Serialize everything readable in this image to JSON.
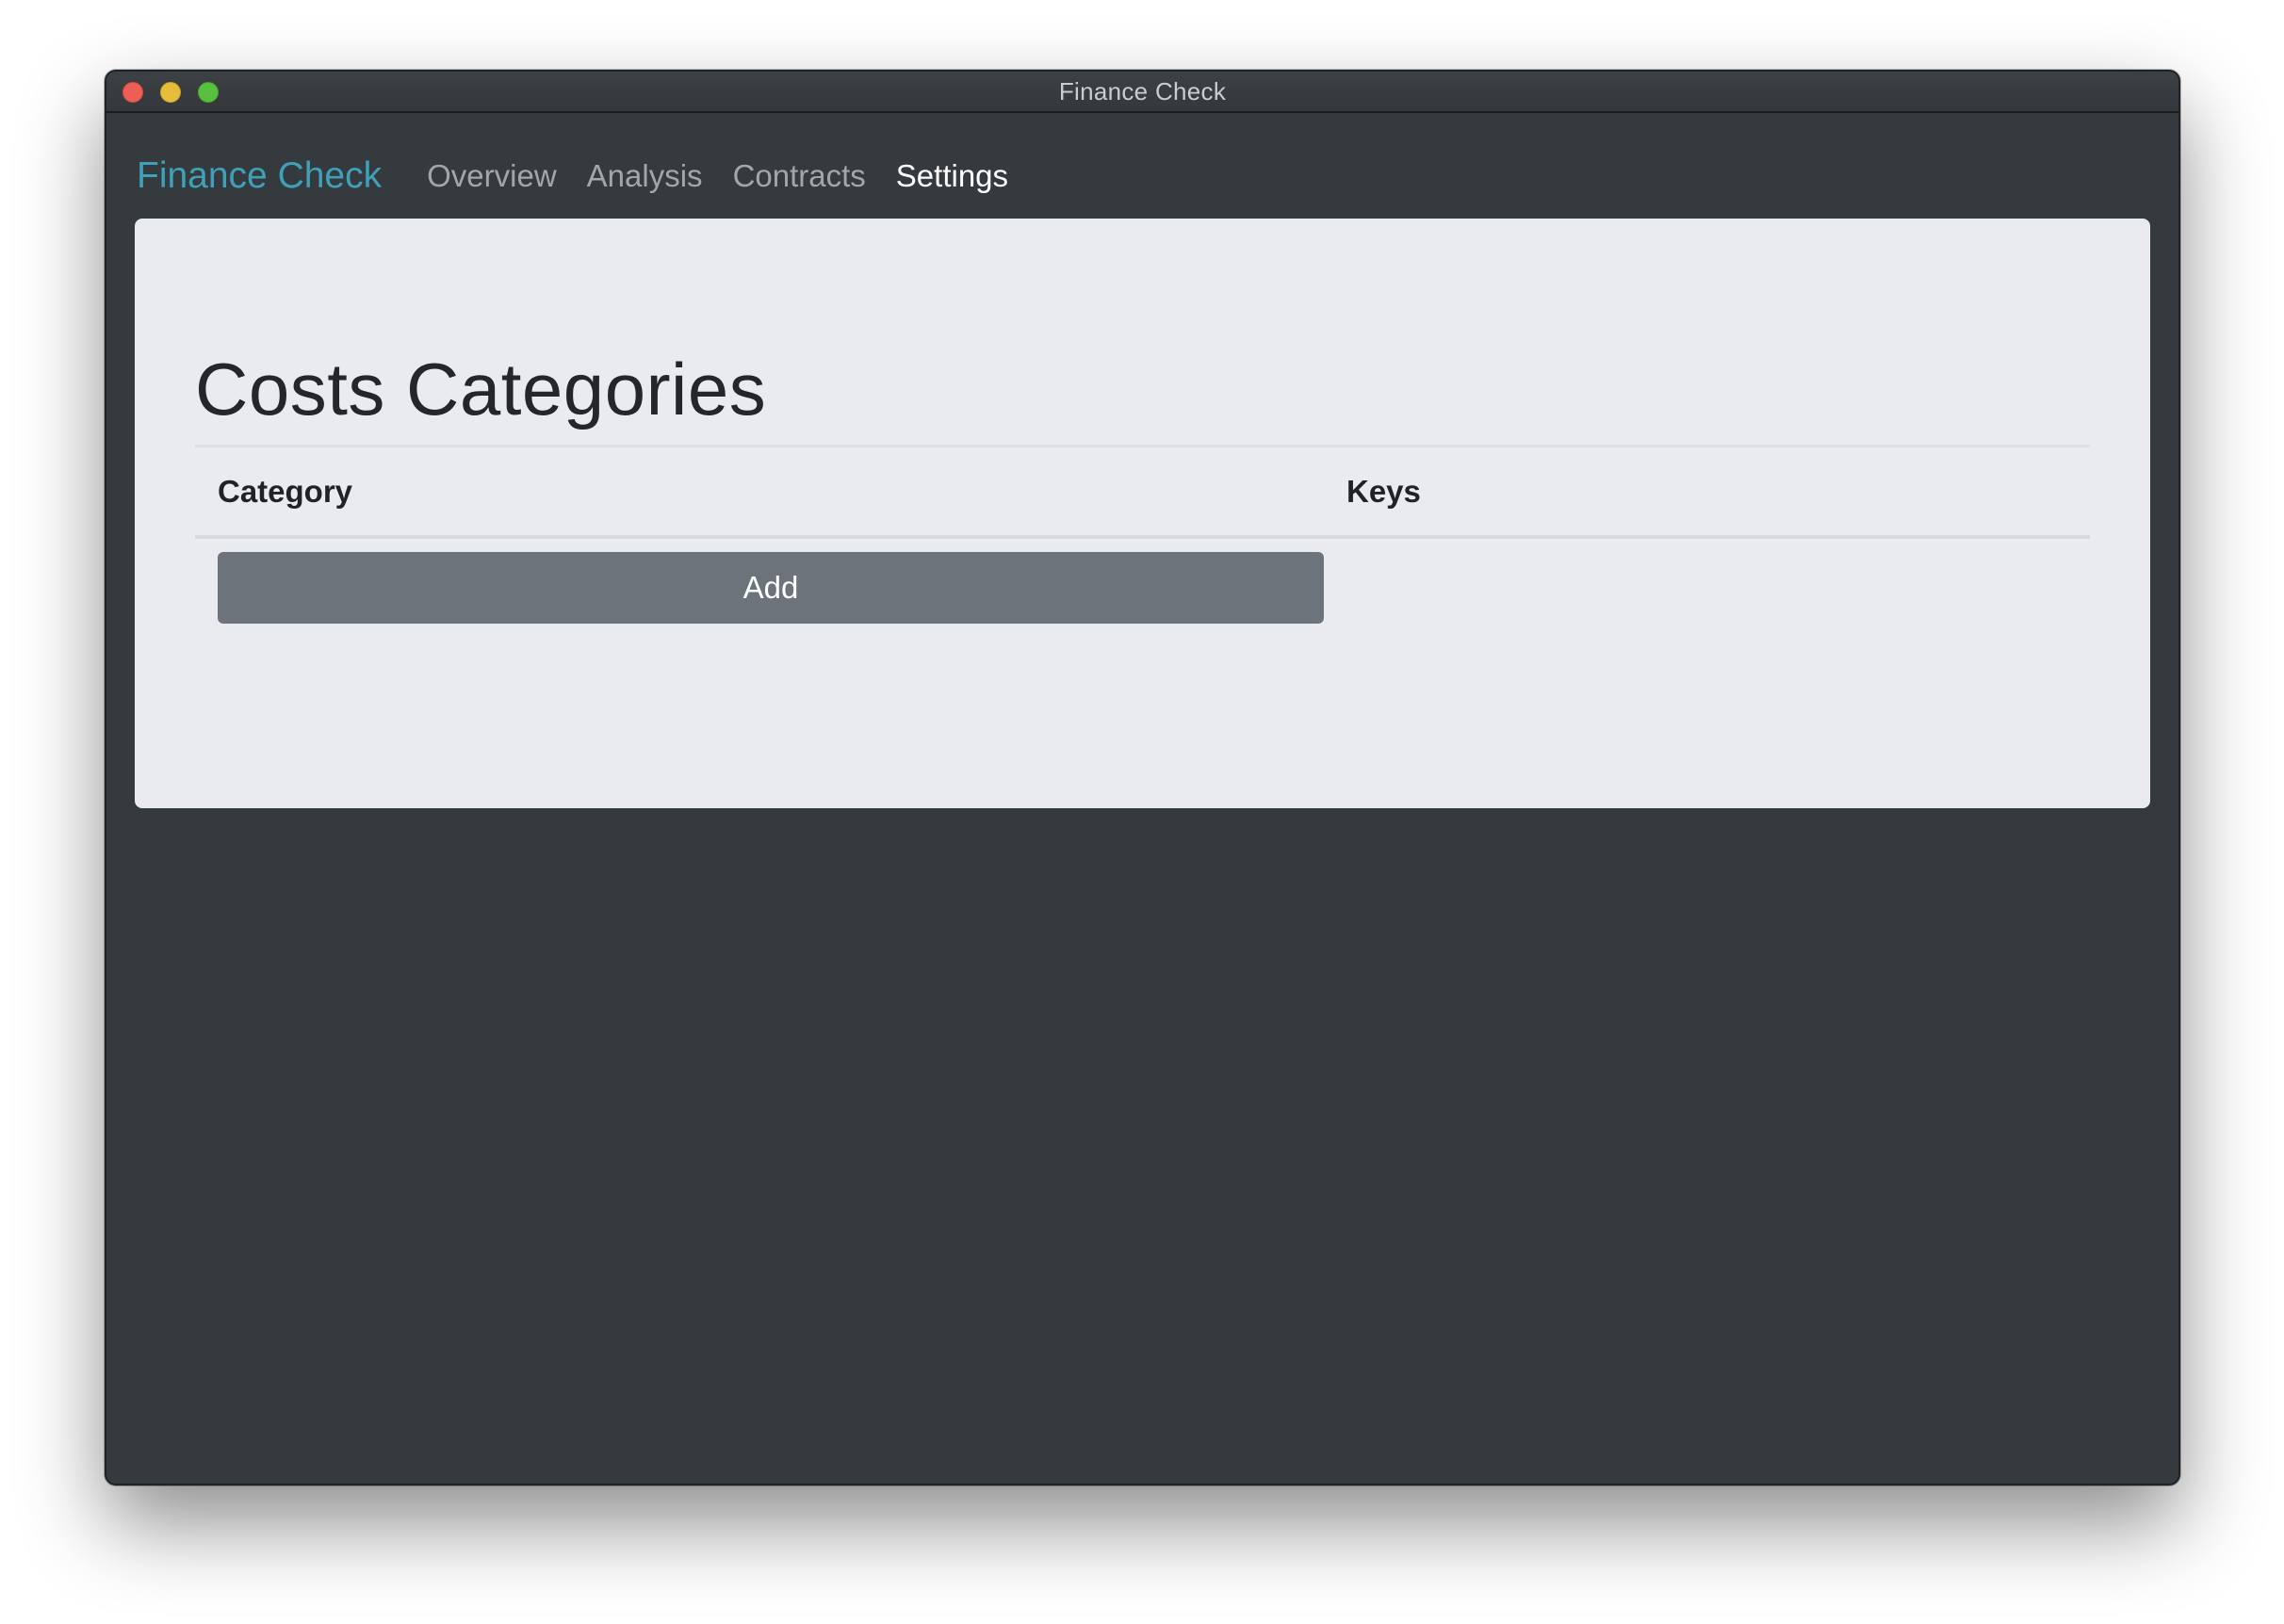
{
  "window": {
    "title": "Finance Check"
  },
  "navbar": {
    "brand": "Finance Check",
    "items": [
      {
        "label": "Overview",
        "active": false
      },
      {
        "label": "Analysis",
        "active": false
      },
      {
        "label": "Contracts",
        "active": false
      },
      {
        "label": "Settings",
        "active": true
      }
    ]
  },
  "main": {
    "title": "Costs Categories",
    "table": {
      "columns": [
        "Category",
        "Keys"
      ],
      "add_label": "Add"
    }
  },
  "colors": {
    "brand": "#3fa0b8",
    "background": "#353a3f",
    "card": "#e9ebef",
    "button": "#6c737b"
  }
}
